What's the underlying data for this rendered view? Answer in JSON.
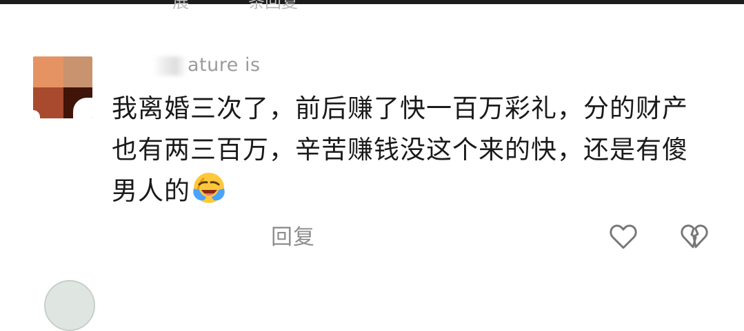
{
  "top_fragment": {
    "left_text": "展",
    "right_text": "条回复"
  },
  "comment": {
    "avatar_icon": "avatar-image",
    "username": "ature is",
    "text_lines": [
      "我离婚三次了，前后赚了快一百万彩礼，分的财产",
      "也有两三百万，辛苦赚钱没这个来的快，还是有傻",
      "男人的"
    ],
    "emoji_icon": "laugh-cry-emoji-icon",
    "reply_label": "回复",
    "like_icon": "heart-outline-icon",
    "dislike_icon": "broken-heart-icon"
  },
  "colors": {
    "text_primary": "#1a1a1a",
    "text_secondary": "#8e8e8e",
    "top_bar": "#1c1c1c"
  }
}
